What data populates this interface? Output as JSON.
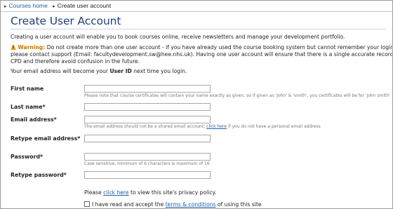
{
  "breadcrumb": {
    "home": "Courses home",
    "current": "Create user account"
  },
  "page": {
    "title": "Create User Account",
    "intro": "Creating a user account will enable you to book courses online, receive newsletters and manage your development portfolio.",
    "warning": {
      "label": "Warning:",
      "line1": "Do not create more than one user account - if you have already used the course booking system but cannot remember your login details",
      "line2": "please contact support (Email: facultydevelopment.sw@hee.nhs.uk). Having one user account will ensure that there is a single accurate record of your",
      "line3": "CPD and therefore avoid confusion in the future."
    },
    "userid_note": {
      "before": "Your email address will become your ",
      "bold": "User ID",
      "after": " next time you login."
    }
  },
  "form": {
    "first_name": {
      "label": "First name",
      "value": "",
      "help": "Please note that course certificates will contain your name exactly as given, so if given as 'john' & 'smith', you certificates will be for 'john smith'"
    },
    "last_name": {
      "label": "Last name*",
      "value": ""
    },
    "email": {
      "label": "Email address*",
      "value": "",
      "help_before": "The email address should not be a shared email account; ",
      "help_link": "click here",
      "help_after": " if you do not have a personal email address"
    },
    "retype_email": {
      "label": "Retype email address*",
      "value": ""
    },
    "password": {
      "label": "Password*",
      "value": "",
      "help": "Case sensitive, minimum of 6 characters & maximum of 16"
    },
    "retype_password": {
      "label": "Retype password*",
      "value": ""
    },
    "privacy": {
      "before": "Please ",
      "link": "click here",
      "after": " to view this site's privacy policy."
    },
    "terms": {
      "checked": false,
      "before": "I have read and accept the ",
      "link": "terms & conditions",
      "after": " of using this site"
    }
  }
}
